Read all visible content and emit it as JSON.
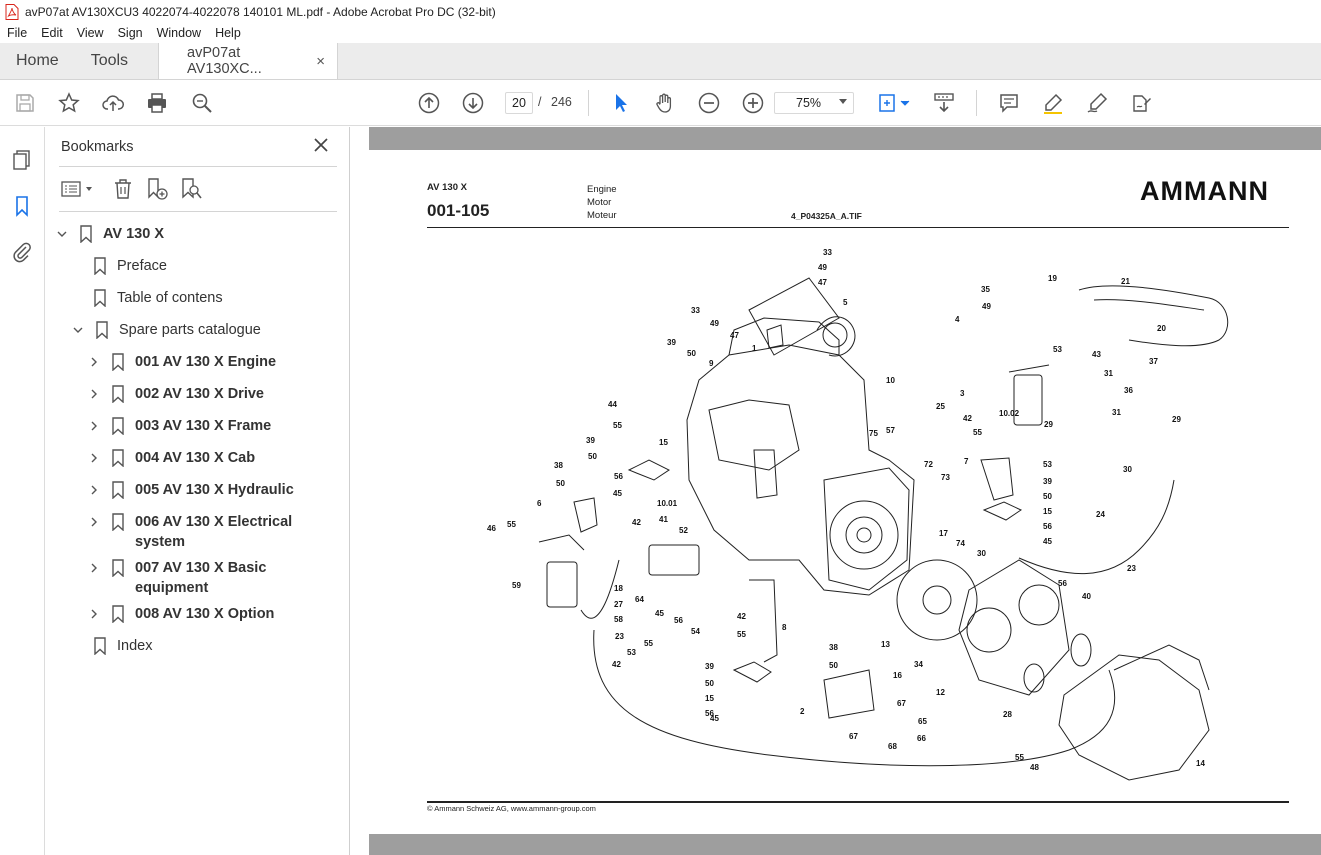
{
  "window": {
    "title": "avP07at AV130XCU3 4022074-4022078 140101 ML.pdf - Adobe Acrobat Pro DC (32-bit)"
  },
  "menu": [
    "File",
    "Edit",
    "View",
    "Sign",
    "Window",
    "Help"
  ],
  "tabs": {
    "home": "Home",
    "tools": "Tools",
    "document": "avP07at AV130XC...",
    "close": "×"
  },
  "toolbar": {
    "current_page": "20",
    "page_separator": "/",
    "total_pages": "246",
    "zoom": "75%"
  },
  "bookmarks": {
    "title": "Bookmarks",
    "items": [
      {
        "label": "AV 130 X"
      },
      {
        "label": "Preface"
      },
      {
        "label": "Table of contens"
      },
      {
        "label": "Spare parts catalogue"
      },
      {
        "label": "001 AV 130 X Engine"
      },
      {
        "label": "002 AV 130 X Drive"
      },
      {
        "label": "003 AV 130 X Frame"
      },
      {
        "label": "004 AV 130 X Cab"
      },
      {
        "label": "005 AV 130 X Hydraulic"
      },
      {
        "label": "006 AV 130 X Electrical system"
      },
      {
        "label": "007 AV 130 X Basic equipment"
      },
      {
        "label": "008 AV 130 X Option"
      },
      {
        "label": "Index"
      }
    ]
  },
  "page": {
    "model": "AV 130 X",
    "code": "001-105",
    "desc_en": "Engine",
    "desc_de": "Motor",
    "desc_fr": "Moteur",
    "file": "4_P04325A_A.TIF",
    "logo": "AMMANN",
    "footer": "© Ammann Schweiz AG, www.ammann-group.com"
  },
  "diagram_labels": [
    "33",
    "49",
    "47",
    "5",
    "33",
    "49",
    "47",
    "1",
    "39",
    "50",
    "9",
    "10",
    "35",
    "49",
    "4",
    "19",
    "21",
    "20",
    "53",
    "43",
    "31",
    "36",
    "37",
    "29",
    "31",
    "29",
    "3",
    "10.02",
    "42",
    "55",
    "44",
    "55",
    "39",
    "50",
    "38",
    "50",
    "15",
    "56",
    "45",
    "10.01",
    "75",
    "57",
    "25",
    "72",
    "73",
    "7",
    "53",
    "39",
    "50",
    "15",
    "56",
    "45",
    "6",
    "41",
    "52",
    "42",
    "46",
    "55",
    "59",
    "18",
    "27",
    "58",
    "17",
    "74",
    "30",
    "30",
    "24",
    "23",
    "64",
    "23",
    "45",
    "56",
    "55",
    "54",
    "42",
    "55",
    "53",
    "42",
    "39",
    "50",
    "15",
    "56",
    "45",
    "8",
    "38",
    "50",
    "16",
    "67",
    "2",
    "65",
    "67",
    "68",
    "66",
    "13",
    "34",
    "12",
    "28",
    "56",
    "40",
    "14",
    "55",
    "48"
  ]
}
